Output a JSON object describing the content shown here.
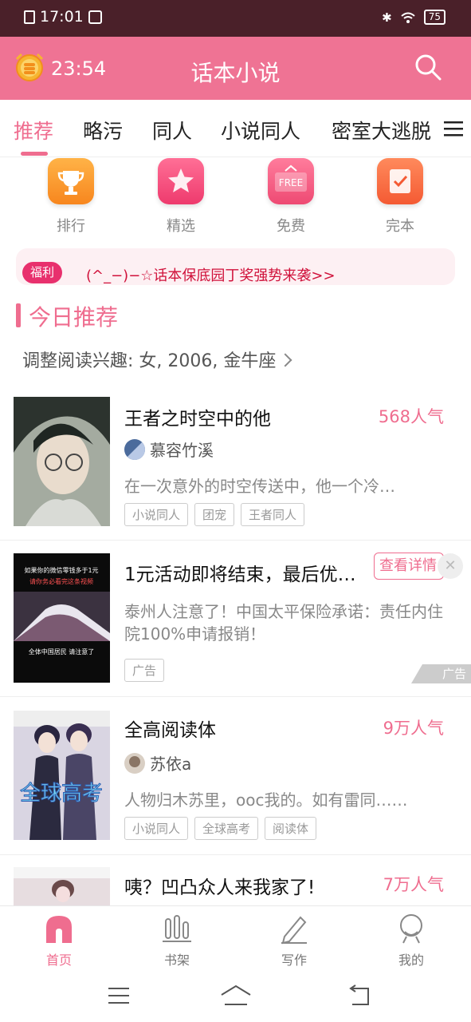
{
  "status_bar": {
    "time": "17:01",
    "battery": "75"
  },
  "header": {
    "timer": "23:54",
    "title": "话本小说"
  },
  "tabs": [
    {
      "label": "推荐",
      "active": true
    },
    {
      "label": "略污"
    },
    {
      "label": "同人"
    },
    {
      "label": "小说同人"
    },
    {
      "label": "密室大逃脱"
    }
  ],
  "quick_links": [
    {
      "label": "排行",
      "icon": "trophy-icon"
    },
    {
      "label": "精选",
      "icon": "star-icon"
    },
    {
      "label": "免费",
      "icon": "free-sign-icon",
      "icon_text": "FREE"
    },
    {
      "label": "完本",
      "icon": "checkbook-icon"
    }
  ],
  "banner": {
    "tag": "福利",
    "text": "(^_−)−☆话本保底园丁奖强势来袭>>"
  },
  "section": {
    "title": "今日推荐",
    "interest": "调整阅读兴趣: 女, 2006, 金牛座"
  },
  "books": [
    {
      "title": "王者之时空中的他",
      "popularity": "568人气",
      "author": "慕容竹溪",
      "desc": "在一次意外的时空传送中，他一个冷…",
      "tags": [
        "小说同人",
        "团宠",
        "王者同人"
      ]
    },
    {
      "title": "全高阅读体",
      "popularity": "9万人气",
      "author": "苏依a",
      "desc": "人物归木苏里，ooc我的。如有雷同……",
      "tags": [
        "小说同人",
        "全球高考",
        "阅读体"
      ]
    },
    {
      "title": "咦？凹凸众人来我家了!",
      "popularity": "7万人气"
    }
  ],
  "ad": {
    "title": "1元活动即将结束，最后优…",
    "button": "查看详情",
    "desc": "泰州人注意了！中国太平保险承诺：责任内住院100%申请报销！",
    "tag": "广告",
    "badge": "广告",
    "close": "✕",
    "image_text_top": "如果你的微信零钱多于1元",
    "image_text_sub": "请你务必看完这条视频",
    "image_text_bottom": "全体中国居民 请注意了"
  },
  "cover_texts": {
    "book2": "全球高考"
  },
  "bottom_nav": [
    {
      "label": "首页",
      "active": true
    },
    {
      "label": "书架"
    },
    {
      "label": "写作"
    },
    {
      "label": "我的"
    }
  ],
  "colors": {
    "brand": "#ef7394",
    "accent": "#ef6d8f",
    "status_bar": "#4a2029",
    "banner_text": "#d0113a"
  }
}
